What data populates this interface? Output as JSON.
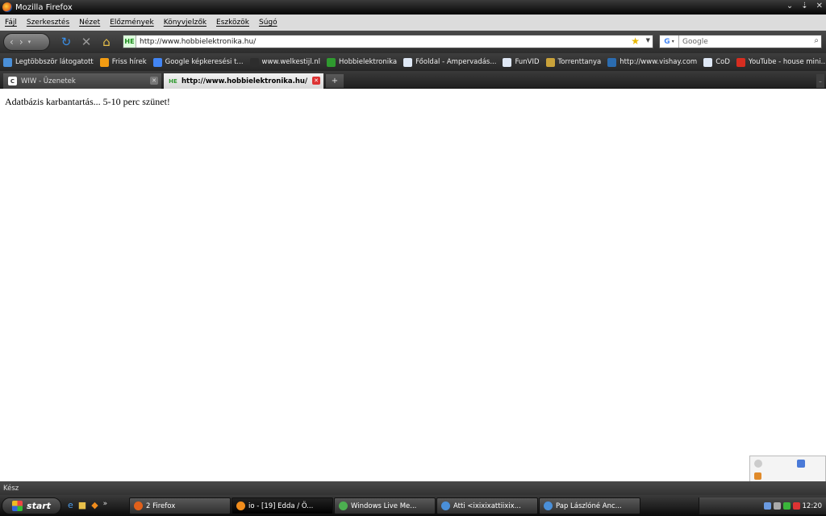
{
  "window": {
    "title": "Mozilla Firefox"
  },
  "menu": [
    "Fájl",
    "Szerkesztés",
    "Nézet",
    "Előzmények",
    "Könyvjelzők",
    "Eszközök",
    "Súgó"
  ],
  "nav": {
    "url": "http://www.hobbielektronika.hu/",
    "site_badge": "HE",
    "search_engine": "Google",
    "search_placeholder": "Google"
  },
  "bookmarks": [
    {
      "label": "Legtöbbször látogatott",
      "icon": "most-visited-icon",
      "color": "#4a8fd8"
    },
    {
      "label": "Friss hírek",
      "icon": "rss-icon",
      "color": "#f39c12"
    },
    {
      "label": "Google képkeresési t...",
      "icon": "google-icon",
      "color": "#4285f4"
    },
    {
      "label": "www.welkestijl.nl",
      "icon": "welkestijl-icon",
      "color": "#2d2d2d"
    },
    {
      "label": "Hobbielektronika",
      "icon": "he-icon",
      "color": "#2f9a2f"
    },
    {
      "label": "Főoldal - Ampervadás...",
      "icon": "page-icon",
      "color": "#dfe8f5"
    },
    {
      "label": "FunVID",
      "icon": "page-icon",
      "color": "#dfe8f5"
    },
    {
      "label": "Torrenttanya",
      "icon": "torrent-icon",
      "color": "#c9a23a"
    },
    {
      "label": "http://www.vishay.com",
      "icon": "vishay-icon",
      "color": "#2b6cb0"
    },
    {
      "label": "CoD",
      "icon": "page-icon",
      "color": "#dfe8f5"
    },
    {
      "label": "YouTube - house mini...",
      "icon": "youtube-icon",
      "color": "#d62d20"
    }
  ],
  "tabs": [
    {
      "label": "WIW - Üzenetek",
      "icon": "wiw-icon",
      "badge": "C",
      "active": false
    },
    {
      "label": "http://www.hobbielektronika.hu/",
      "icon": "he-icon",
      "badge": "HE",
      "active": true
    }
  ],
  "content": {
    "message": "Adatbázis karbantartás... 5-10 perc szünet!"
  },
  "status": {
    "text": "Kész"
  },
  "taskbar": {
    "start_label": "start",
    "tasks": [
      {
        "label": "2 Firefox",
        "icon": "firefox-icon",
        "color": "#e0601a"
      },
      {
        "label": "io - [19] Edda / Ö...",
        "icon": "winamp-icon",
        "color": "#f08c1c"
      },
      {
        "label": "Windows Live Me...",
        "icon": "messenger-icon",
        "color": "#4caf50"
      },
      {
        "label": "Atti <ixixixattiixix...",
        "icon": "messenger-user-icon",
        "color": "#4a8fd8"
      },
      {
        "label": "Pap Lászlóné Anc...",
        "icon": "messenger-user-icon",
        "color": "#4a8fd8"
      }
    ],
    "clock": "12:20"
  }
}
